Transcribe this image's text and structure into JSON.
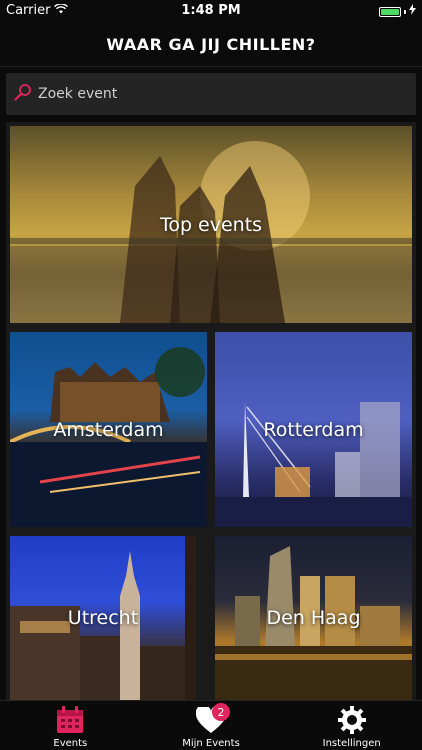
{
  "status": {
    "carrier": "Carrier",
    "time": "1:48 PM"
  },
  "nav": {
    "title": "WAAR GA JIJ CHILLEN?"
  },
  "search": {
    "placeholder": "Zoek event",
    "value": ""
  },
  "tiles": [
    {
      "label": "Top events"
    },
    {
      "label": "Amsterdam"
    },
    {
      "label": "Rotterdam"
    },
    {
      "label": "Utrecht"
    },
    {
      "label": "Den Haag"
    }
  ],
  "tabbar": {
    "items": [
      {
        "label": "Events",
        "icon": "calendar-icon"
      },
      {
        "label": "Mijn Events",
        "icon": "heart-icon",
        "badge": "2"
      },
      {
        "label": "Instellingen",
        "icon": "gear-icon"
      }
    ]
  },
  "colors": {
    "accent": "#e0245e",
    "background": "#0b0b0b"
  }
}
